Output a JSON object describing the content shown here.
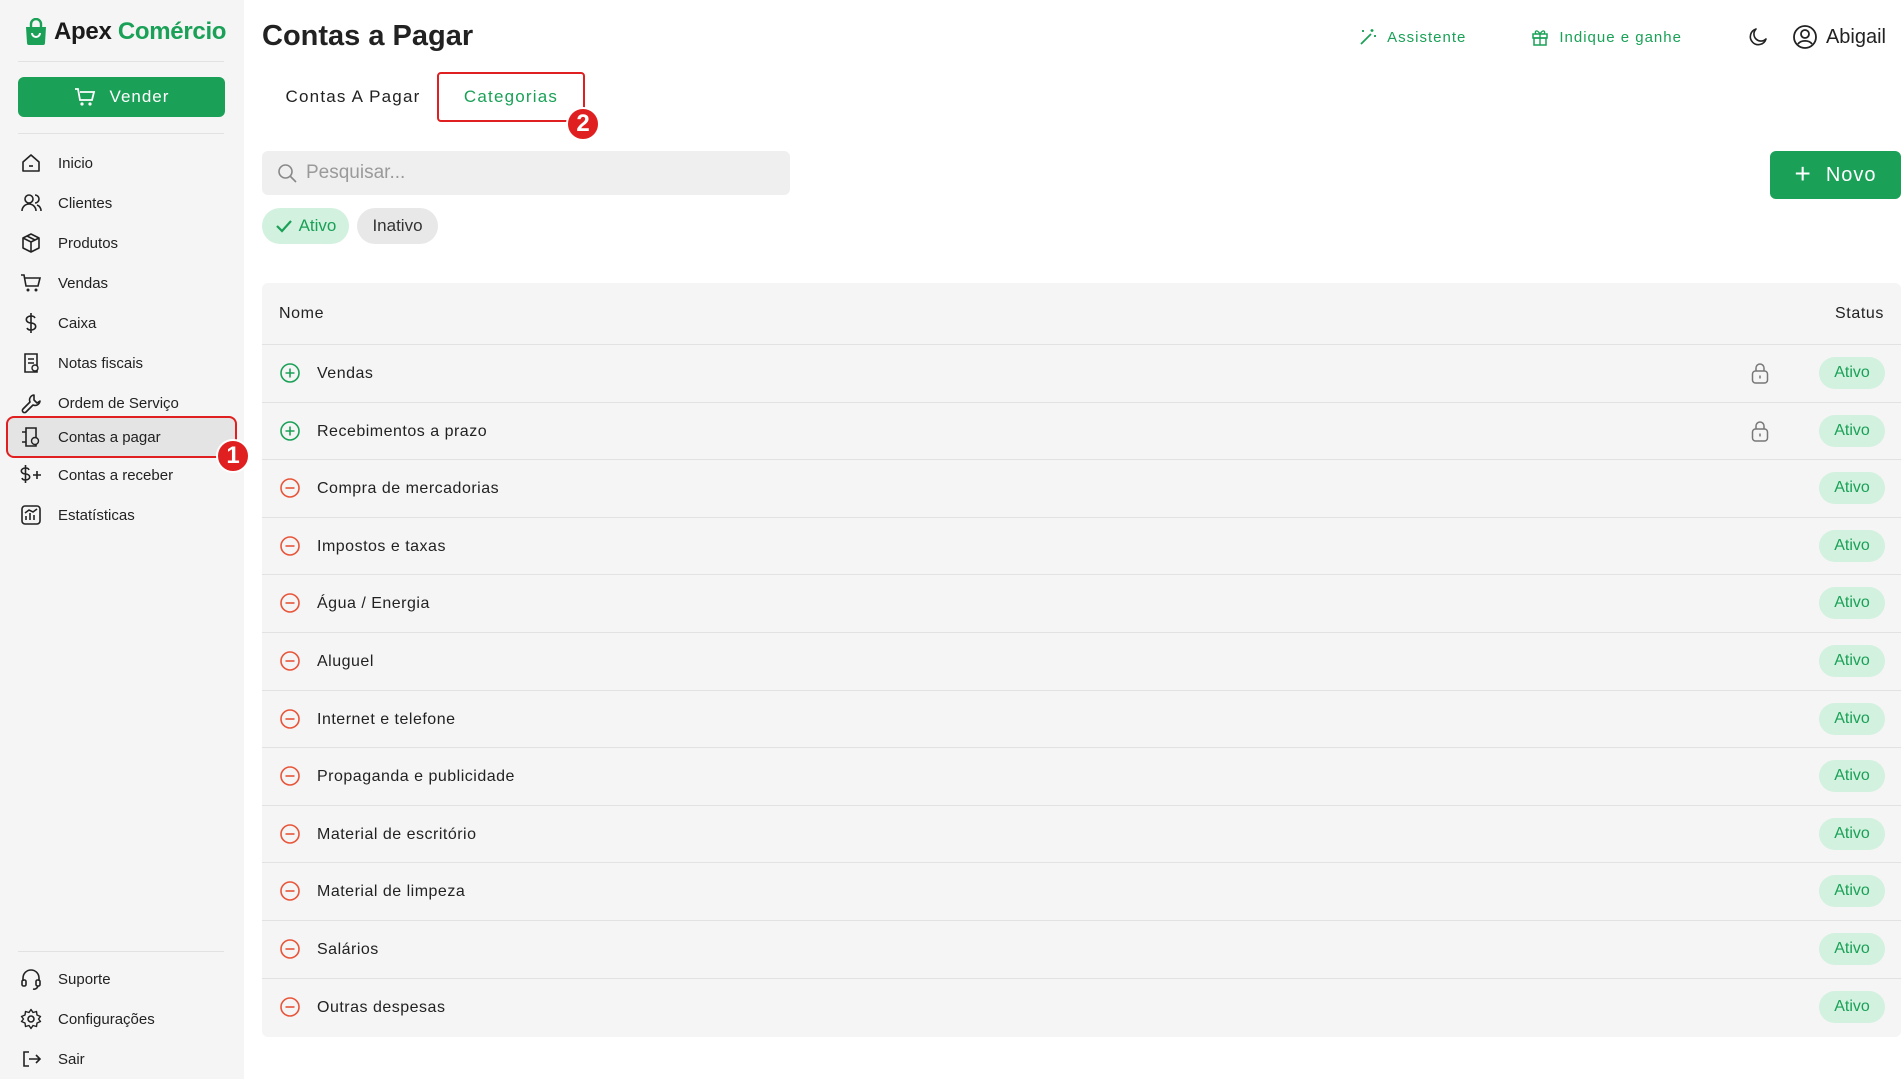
{
  "brand": {
    "name_part1": "Apex",
    "name_part2": "Comércio"
  },
  "sidebar": {
    "sell_label": "Vender",
    "items": [
      {
        "label": "Inicio",
        "icon": "home-icon"
      },
      {
        "label": "Clientes",
        "icon": "users-icon"
      },
      {
        "label": "Produtos",
        "icon": "box-icon"
      },
      {
        "label": "Vendas",
        "icon": "cart-icon"
      },
      {
        "label": "Caixa",
        "icon": "dollar-icon"
      },
      {
        "label": "Notas fiscais",
        "icon": "invoice-icon"
      },
      {
        "label": "Ordem de Serviço",
        "icon": "wrench-icon"
      },
      {
        "label": "Contas a pagar",
        "icon": "payable-icon"
      },
      {
        "label": "Contas a receber",
        "icon": "receivable-icon"
      },
      {
        "label": "Estatísticas",
        "icon": "chart-icon"
      }
    ],
    "bottom_items": [
      {
        "label": "Suporte",
        "icon": "headset-icon"
      },
      {
        "label": "Configurações",
        "icon": "gear-icon"
      },
      {
        "label": "Sair",
        "icon": "logout-icon"
      }
    ],
    "active_index": 7
  },
  "header": {
    "title": "Contas a Pagar",
    "assistant_label": "Assistente",
    "referral_label": "Indique e ganhe",
    "user_name": "Abigail"
  },
  "tabs": [
    {
      "label": "Contas A Pagar",
      "active": false
    },
    {
      "label": "Categorias",
      "active": true
    }
  ],
  "annotations": {
    "step1": "1",
    "step2": "2"
  },
  "search": {
    "placeholder": "Pesquisar..."
  },
  "new_button_label": "Novo",
  "filters": [
    {
      "label": "Ativo",
      "selected": true
    },
    {
      "label": "Inativo",
      "selected": false
    }
  ],
  "table": {
    "columns": [
      "Nome",
      "Status"
    ],
    "rows": [
      {
        "name": "Vendas",
        "type": "income",
        "locked": true,
        "status": "Ativo"
      },
      {
        "name": "Recebimentos a prazo",
        "type": "income",
        "locked": true,
        "status": "Ativo"
      },
      {
        "name": "Compra de mercadorias",
        "type": "expense",
        "locked": false,
        "status": "Ativo"
      },
      {
        "name": "Impostos e taxas",
        "type": "expense",
        "locked": false,
        "status": "Ativo"
      },
      {
        "name": "Água / Energia",
        "type": "expense",
        "locked": false,
        "status": "Ativo"
      },
      {
        "name": "Aluguel",
        "type": "expense",
        "locked": false,
        "status": "Ativo"
      },
      {
        "name": "Internet e telefone",
        "type": "expense",
        "locked": false,
        "status": "Ativo"
      },
      {
        "name": "Propaganda e publicidade",
        "type": "expense",
        "locked": false,
        "status": "Ativo"
      },
      {
        "name": "Material de escritório",
        "type": "expense",
        "locked": false,
        "status": "Ativo"
      },
      {
        "name": "Material de limpeza",
        "type": "expense",
        "locked": false,
        "status": "Ativo"
      },
      {
        "name": "Salários",
        "type": "expense",
        "locked": false,
        "status": "Ativo"
      },
      {
        "name": "Outras despesas",
        "type": "expense",
        "locked": false,
        "status": "Ativo"
      }
    ]
  },
  "colors": {
    "brand_green": "#1aa157",
    "income": "#1aa157",
    "expense": "#e8553a",
    "highlight": "#e02020"
  }
}
